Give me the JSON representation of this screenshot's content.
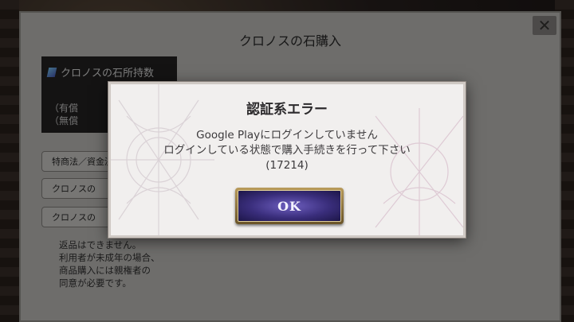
{
  "store": {
    "title": "クロノスの石購入",
    "close_glyph": "✕",
    "stone_box": {
      "header": "クロノスの石所持数",
      "paid_label": "（有償",
      "free_label": "（無償"
    },
    "buttons": [
      {
        "label": "特商法／資金決"
      },
      {
        "label": "クロノスの"
      },
      {
        "label": "クロノスの"
      }
    ],
    "note": "返品はできません。\n利用者が未成年の場合、\n商品購入には親権者の\n同意が必要です。"
  },
  "dialog": {
    "title": "認証系エラー",
    "message_line1": "Google Playにログインしていません",
    "message_line2": "ログインしている状態で購入手続きを行って下さい",
    "error_code": "(17214)",
    "ok_label": "OK"
  },
  "colors": {
    "dialog_bg": "#f1efee",
    "ok_button": "#3a2e7c",
    "ok_border": "#b89a5a"
  }
}
